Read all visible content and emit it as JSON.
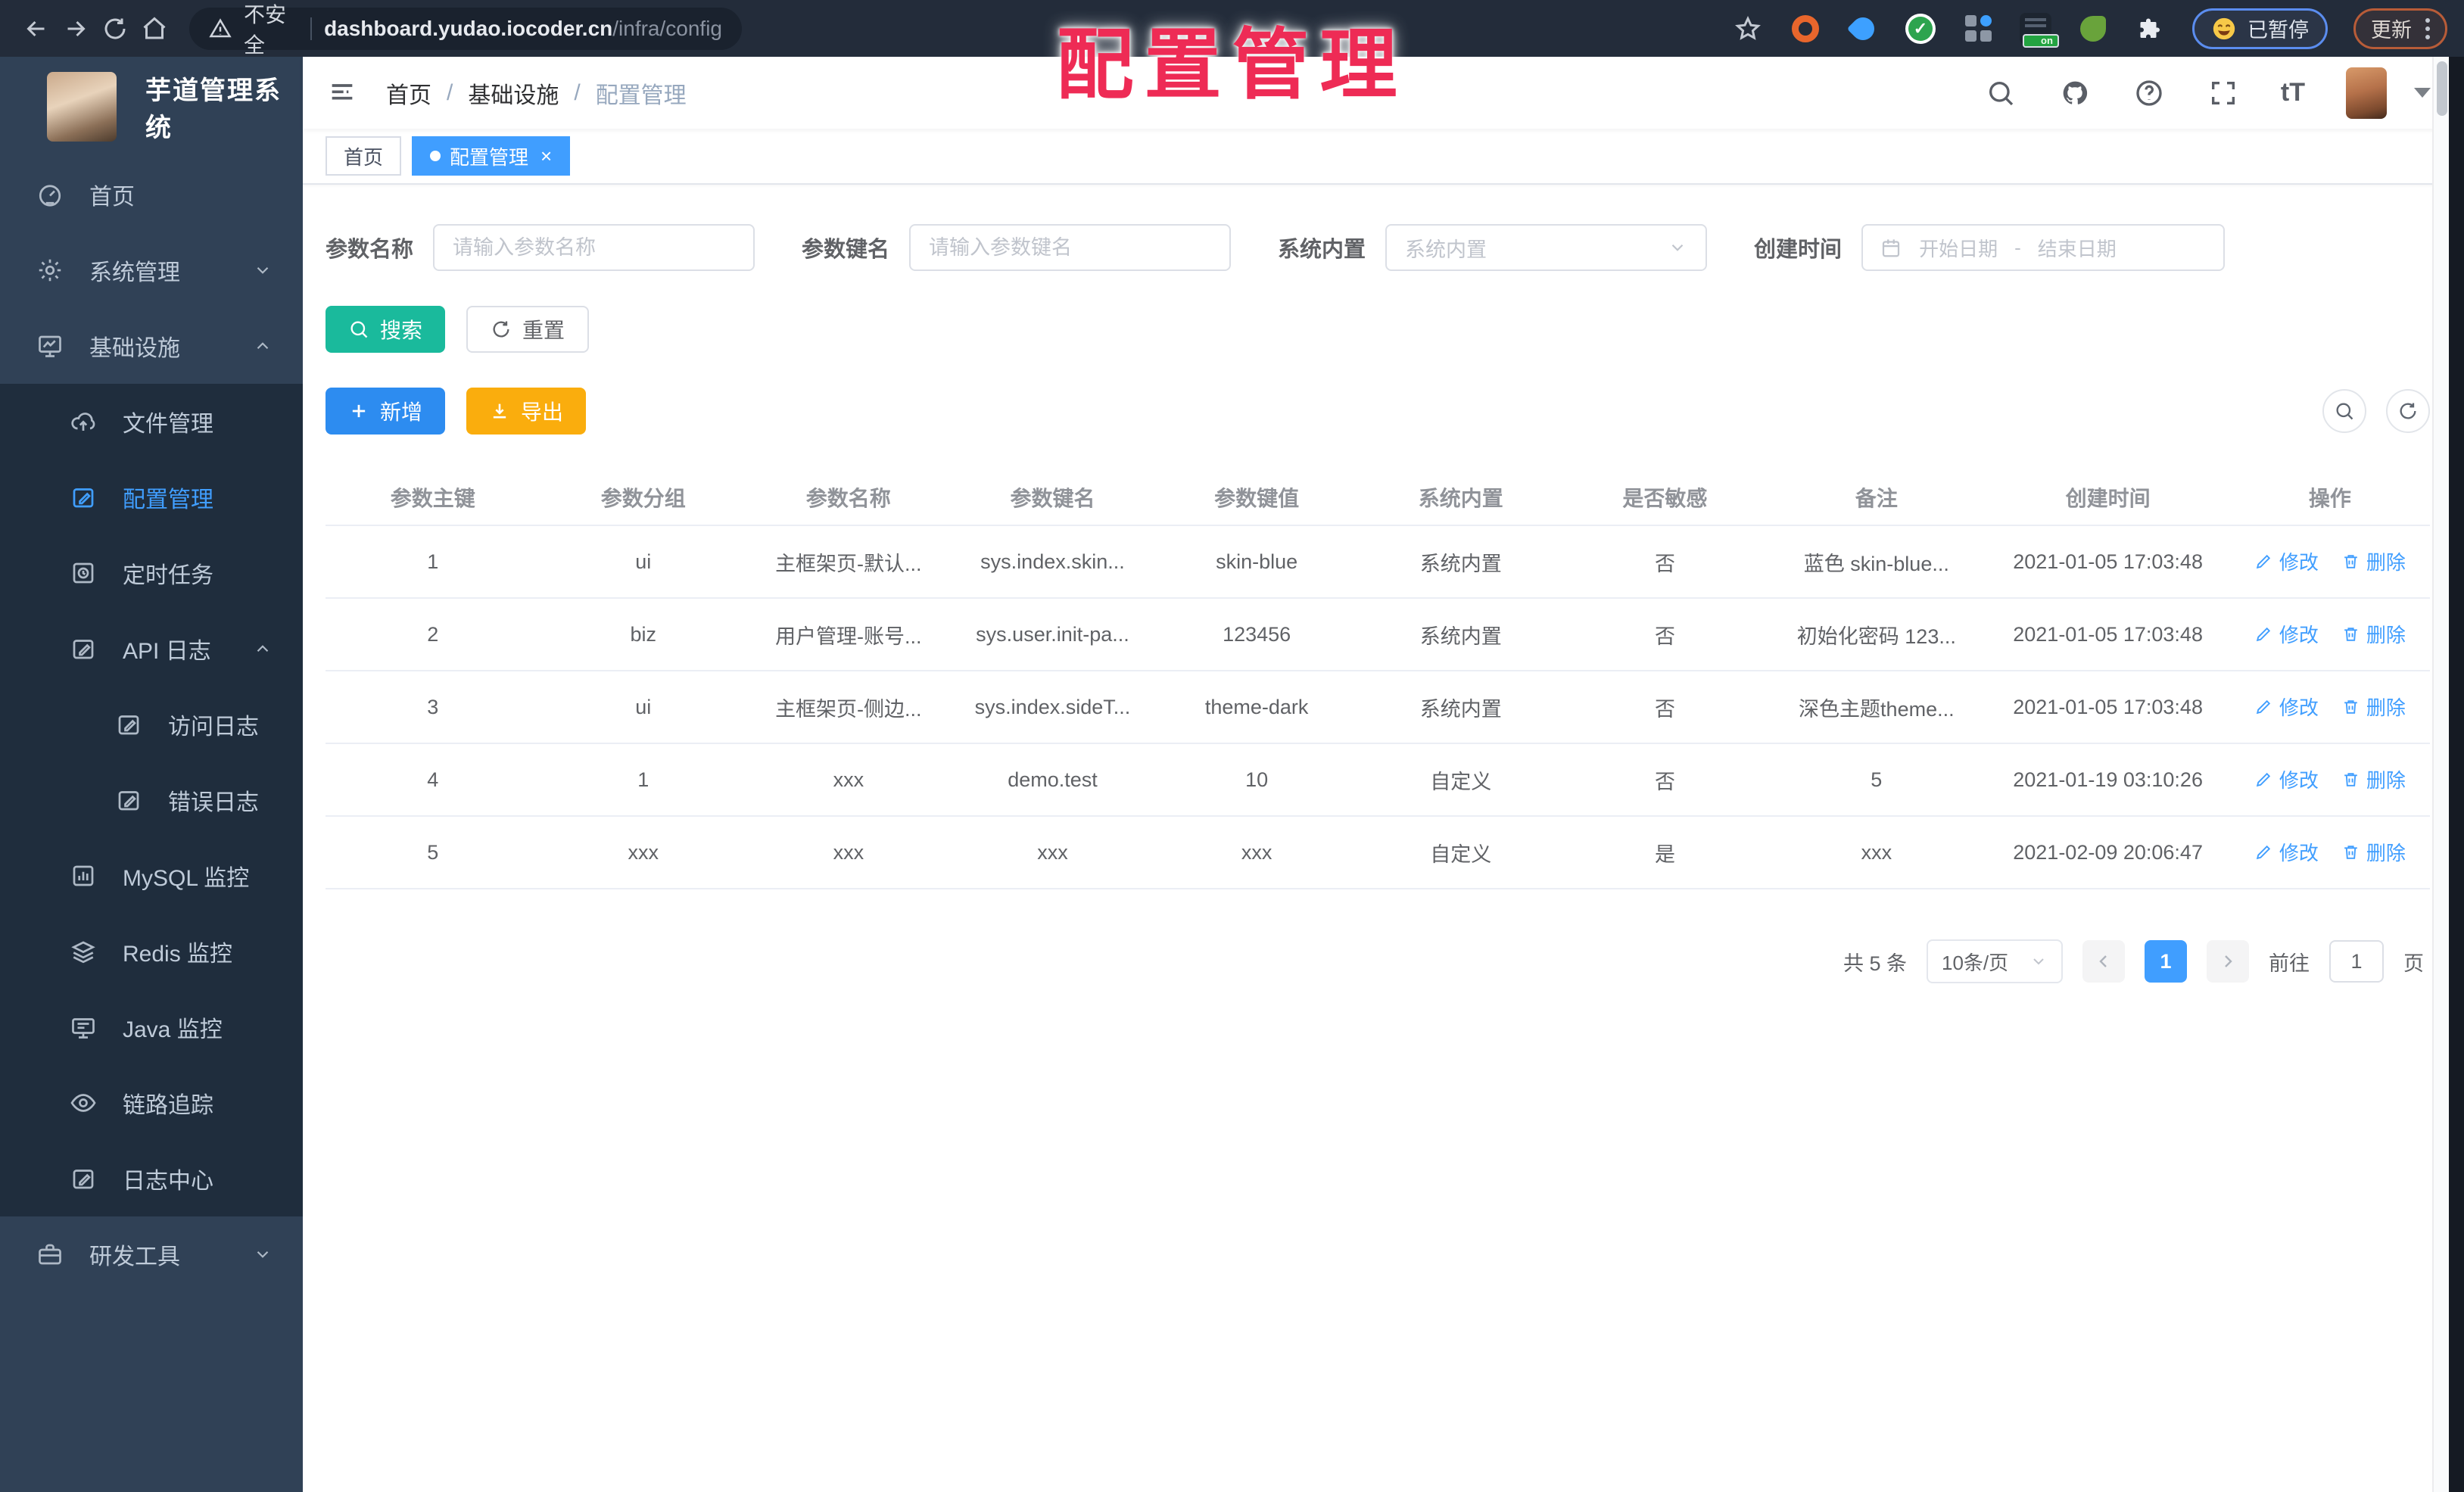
{
  "browser": {
    "security_label": "不安全",
    "url_host": "dashboard.yudao.iocoder.cn",
    "url_path": "/infra/config",
    "paused_badge": "已暂停",
    "update_button": "更新"
  },
  "overlay_title": "配置管理",
  "sidebar": {
    "title": "芋道管理系统",
    "items": [
      {
        "label": "首页"
      },
      {
        "label": "系统管理"
      },
      {
        "label": "基础设施"
      },
      {
        "label": "文件管理"
      },
      {
        "label": "配置管理"
      },
      {
        "label": "定时任务"
      },
      {
        "label": "API 日志"
      },
      {
        "label": "访问日志"
      },
      {
        "label": "错误日志"
      },
      {
        "label": "MySQL 监控"
      },
      {
        "label": "Redis 监控"
      },
      {
        "label": "Java 监控"
      },
      {
        "label": "链路追踪"
      },
      {
        "label": "日志中心"
      },
      {
        "label": "研发工具"
      }
    ]
  },
  "header": {
    "breadcrumb": [
      "首页",
      "基础设施",
      "配置管理"
    ]
  },
  "tags": [
    {
      "label": "首页"
    },
    {
      "label": "配置管理"
    }
  ],
  "filters": {
    "name_label": "参数名称",
    "name_placeholder": "请输入参数名称",
    "key_label": "参数键名",
    "key_placeholder": "请输入参数键名",
    "type_label": "系统内置",
    "type_placeholder": "系统内置",
    "date_label": "创建时间",
    "date_start": "开始日期",
    "date_separator": "-",
    "date_end": "结束日期"
  },
  "buttons": {
    "search": "搜索",
    "reset": "重置",
    "add": "新增",
    "export": "导出"
  },
  "table": {
    "columns": [
      "参数主键",
      "参数分组",
      "参数名称",
      "参数键名",
      "参数键值",
      "系统内置",
      "是否敏感",
      "备注",
      "创建时间",
      "操作"
    ],
    "edit_label": "修改",
    "delete_label": "删除",
    "rows": [
      {
        "cells": [
          "1",
          "ui",
          "主框架页-默认...",
          "sys.index.skin...",
          "skin-blue",
          "系统内置",
          "否",
          "蓝色 skin-blue...",
          "2021-01-05 17:03:48"
        ]
      },
      {
        "cells": [
          "2",
          "biz",
          "用户管理-账号...",
          "sys.user.init-pa...",
          "123456",
          "系统内置",
          "否",
          "初始化密码 123...",
          "2021-01-05 17:03:48"
        ]
      },
      {
        "cells": [
          "3",
          "ui",
          "主框架页-侧边...",
          "sys.index.sideT...",
          "theme-dark",
          "系统内置",
          "否",
          "深色主题theme...",
          "2021-01-05 17:03:48"
        ]
      },
      {
        "cells": [
          "4",
          "1",
          "xxx",
          "demo.test",
          "10",
          "自定义",
          "否",
          "5",
          "2021-01-19 03:10:26"
        ]
      },
      {
        "cells": [
          "5",
          "xxx",
          "xxx",
          "xxx",
          "xxx",
          "自定义",
          "是",
          "xxx",
          "2021-02-09 20:06:47"
        ]
      }
    ]
  },
  "pagination": {
    "total": "共 5 条",
    "page_size": "10条/页",
    "current_page": "1",
    "goto_label": "前往",
    "goto_value": "1",
    "page_unit": "页"
  },
  "colors": {
    "accent": "#409eff",
    "search_button": "#1aba9c",
    "add_button": "#2d8cf0",
    "export_button": "#faad0d",
    "overlay_red": "#ee2b55",
    "sidebar_bg": "#304156",
    "submenu_bg": "#1f2d3d"
  }
}
